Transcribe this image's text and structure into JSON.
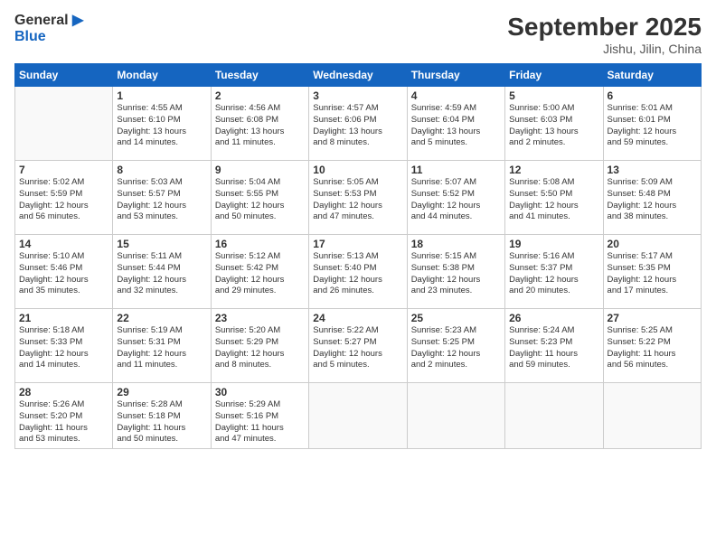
{
  "header": {
    "logo_general": "General",
    "logo_blue": "Blue",
    "month_title": "September 2025",
    "location": "Jishu, Jilin, China"
  },
  "weekdays": [
    "Sunday",
    "Monday",
    "Tuesday",
    "Wednesday",
    "Thursday",
    "Friday",
    "Saturday"
  ],
  "weeks": [
    [
      {
        "day": "",
        "info": ""
      },
      {
        "day": "1",
        "info": "Sunrise: 4:55 AM\nSunset: 6:10 PM\nDaylight: 13 hours\nand 14 minutes."
      },
      {
        "day": "2",
        "info": "Sunrise: 4:56 AM\nSunset: 6:08 PM\nDaylight: 13 hours\nand 11 minutes."
      },
      {
        "day": "3",
        "info": "Sunrise: 4:57 AM\nSunset: 6:06 PM\nDaylight: 13 hours\nand 8 minutes."
      },
      {
        "day": "4",
        "info": "Sunrise: 4:59 AM\nSunset: 6:04 PM\nDaylight: 13 hours\nand 5 minutes."
      },
      {
        "day": "5",
        "info": "Sunrise: 5:00 AM\nSunset: 6:03 PM\nDaylight: 13 hours\nand 2 minutes."
      },
      {
        "day": "6",
        "info": "Sunrise: 5:01 AM\nSunset: 6:01 PM\nDaylight: 12 hours\nand 59 minutes."
      }
    ],
    [
      {
        "day": "7",
        "info": "Sunrise: 5:02 AM\nSunset: 5:59 PM\nDaylight: 12 hours\nand 56 minutes."
      },
      {
        "day": "8",
        "info": "Sunrise: 5:03 AM\nSunset: 5:57 PM\nDaylight: 12 hours\nand 53 minutes."
      },
      {
        "day": "9",
        "info": "Sunrise: 5:04 AM\nSunset: 5:55 PM\nDaylight: 12 hours\nand 50 minutes."
      },
      {
        "day": "10",
        "info": "Sunrise: 5:05 AM\nSunset: 5:53 PM\nDaylight: 12 hours\nand 47 minutes."
      },
      {
        "day": "11",
        "info": "Sunrise: 5:07 AM\nSunset: 5:52 PM\nDaylight: 12 hours\nand 44 minutes."
      },
      {
        "day": "12",
        "info": "Sunrise: 5:08 AM\nSunset: 5:50 PM\nDaylight: 12 hours\nand 41 minutes."
      },
      {
        "day": "13",
        "info": "Sunrise: 5:09 AM\nSunset: 5:48 PM\nDaylight: 12 hours\nand 38 minutes."
      }
    ],
    [
      {
        "day": "14",
        "info": "Sunrise: 5:10 AM\nSunset: 5:46 PM\nDaylight: 12 hours\nand 35 minutes."
      },
      {
        "day": "15",
        "info": "Sunrise: 5:11 AM\nSunset: 5:44 PM\nDaylight: 12 hours\nand 32 minutes."
      },
      {
        "day": "16",
        "info": "Sunrise: 5:12 AM\nSunset: 5:42 PM\nDaylight: 12 hours\nand 29 minutes."
      },
      {
        "day": "17",
        "info": "Sunrise: 5:13 AM\nSunset: 5:40 PM\nDaylight: 12 hours\nand 26 minutes."
      },
      {
        "day": "18",
        "info": "Sunrise: 5:15 AM\nSunset: 5:38 PM\nDaylight: 12 hours\nand 23 minutes."
      },
      {
        "day": "19",
        "info": "Sunrise: 5:16 AM\nSunset: 5:37 PM\nDaylight: 12 hours\nand 20 minutes."
      },
      {
        "day": "20",
        "info": "Sunrise: 5:17 AM\nSunset: 5:35 PM\nDaylight: 12 hours\nand 17 minutes."
      }
    ],
    [
      {
        "day": "21",
        "info": "Sunrise: 5:18 AM\nSunset: 5:33 PM\nDaylight: 12 hours\nand 14 minutes."
      },
      {
        "day": "22",
        "info": "Sunrise: 5:19 AM\nSunset: 5:31 PM\nDaylight: 12 hours\nand 11 minutes."
      },
      {
        "day": "23",
        "info": "Sunrise: 5:20 AM\nSunset: 5:29 PM\nDaylight: 12 hours\nand 8 minutes."
      },
      {
        "day": "24",
        "info": "Sunrise: 5:22 AM\nSunset: 5:27 PM\nDaylight: 12 hours\nand 5 minutes."
      },
      {
        "day": "25",
        "info": "Sunrise: 5:23 AM\nSunset: 5:25 PM\nDaylight: 12 hours\nand 2 minutes."
      },
      {
        "day": "26",
        "info": "Sunrise: 5:24 AM\nSunset: 5:23 PM\nDaylight: 11 hours\nand 59 minutes."
      },
      {
        "day": "27",
        "info": "Sunrise: 5:25 AM\nSunset: 5:22 PM\nDaylight: 11 hours\nand 56 minutes."
      }
    ],
    [
      {
        "day": "28",
        "info": "Sunrise: 5:26 AM\nSunset: 5:20 PM\nDaylight: 11 hours\nand 53 minutes."
      },
      {
        "day": "29",
        "info": "Sunrise: 5:28 AM\nSunset: 5:18 PM\nDaylight: 11 hours\nand 50 minutes."
      },
      {
        "day": "30",
        "info": "Sunrise: 5:29 AM\nSunset: 5:16 PM\nDaylight: 11 hours\nand 47 minutes."
      },
      {
        "day": "",
        "info": ""
      },
      {
        "day": "",
        "info": ""
      },
      {
        "day": "",
        "info": ""
      },
      {
        "day": "",
        "info": ""
      }
    ]
  ]
}
